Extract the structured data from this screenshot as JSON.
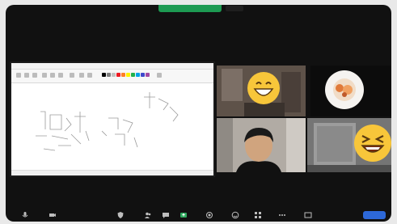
{
  "window": {
    "sharing_banner": "",
    "top_badge": "",
    "view_button": ""
  },
  "share": {
    "app": "paint",
    "ribbon_swatches": [
      "#000000",
      "#7f7f7f",
      "#c3c3c3",
      "#ed1c24",
      "#ff7f27",
      "#fff200",
      "#22b14c",
      "#00a2e8",
      "#3f48cc",
      "#a349a4"
    ]
  },
  "participants": [
    {
      "id": "participant-1",
      "overlay": "grinning-emoji"
    },
    {
      "id": "participant-2",
      "overlay": "avatar-image"
    },
    {
      "id": "participant-3",
      "overlay": "person-video"
    },
    {
      "id": "participant-4",
      "overlay": "squinting-laugh-emoji"
    }
  ],
  "toolbar": {
    "icons": [
      "microphone-icon",
      "video-icon",
      "security-icon",
      "participants-icon",
      "chat-icon",
      "share-screen-icon",
      "record-icon",
      "reactions-icon",
      "apps-icon",
      "more-icon"
    ],
    "end_label": ""
  },
  "colors": {
    "window_bg": "#111111",
    "banner_green": "#1d9a52",
    "end_button_blue": "#2d68d8",
    "emoji_yellow": "#f8c63a"
  }
}
